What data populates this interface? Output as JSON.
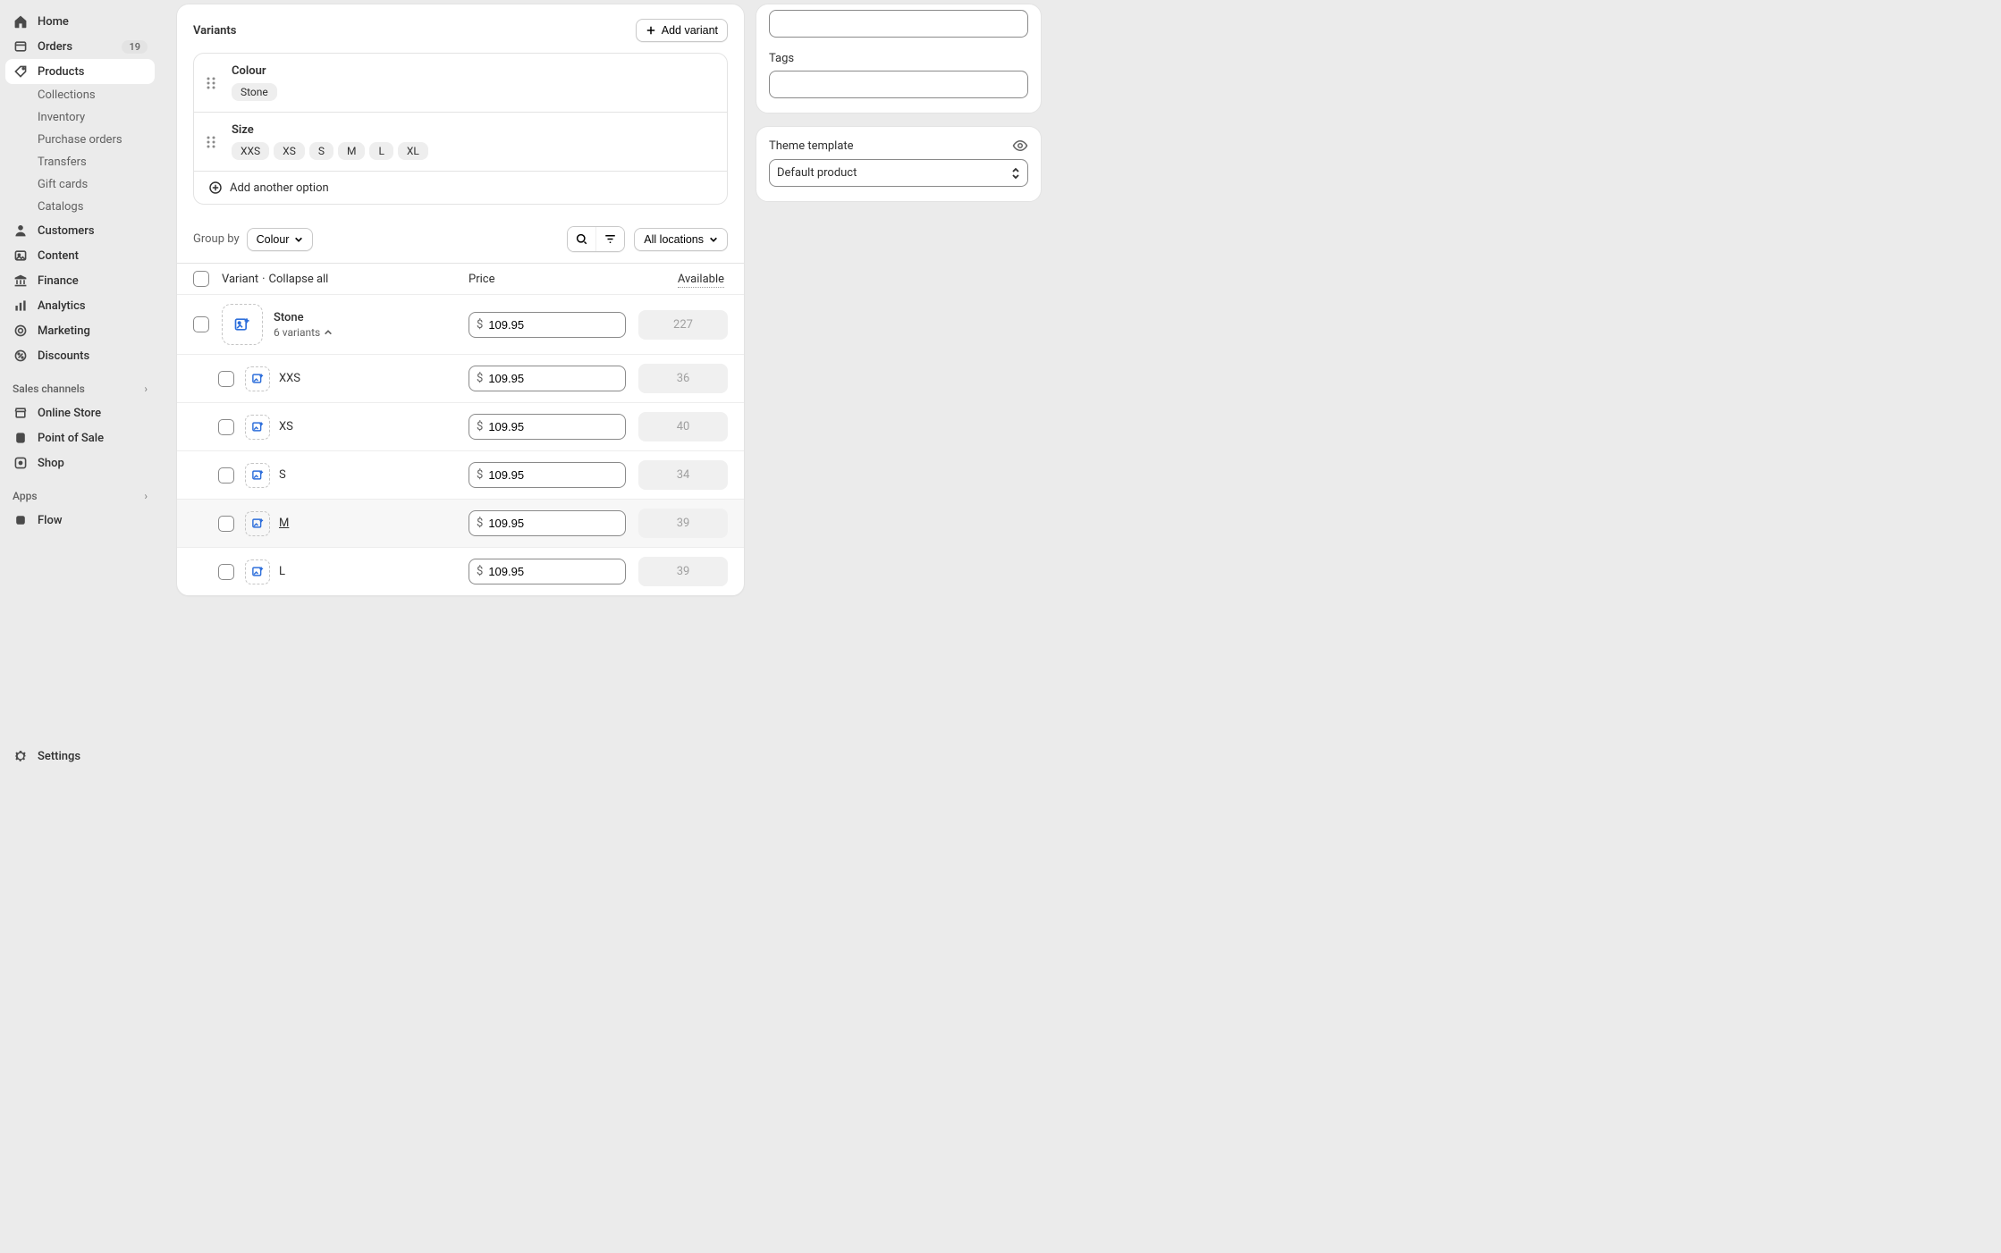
{
  "sidebar": {
    "home": "Home",
    "orders": "Orders",
    "orders_badge": "19",
    "products": "Products",
    "products_sub": [
      "Collections",
      "Inventory",
      "Purchase orders",
      "Transfers",
      "Gift cards",
      "Catalogs"
    ],
    "customers": "Customers",
    "content": "Content",
    "finance": "Finance",
    "analytics": "Analytics",
    "marketing": "Marketing",
    "discounts": "Discounts",
    "sales_header": "Sales channels",
    "online_store": "Online Store",
    "pos": "Point of Sale",
    "shop": "Shop",
    "apps_header": "Apps",
    "flow": "Flow",
    "settings": "Settings"
  },
  "variants": {
    "title": "Variants",
    "add_variant": "Add variant",
    "options": [
      {
        "name": "Colour",
        "values": [
          "Stone"
        ]
      },
      {
        "name": "Size",
        "values": [
          "XXS",
          "XS",
          "S",
          "M",
          "L",
          "XL"
        ]
      }
    ],
    "add_option": "Add another option",
    "group_by_label": "Group by",
    "group_by_value": "Colour",
    "locations": "All locations",
    "header": {
      "variant": "Variant",
      "collapse": "Collapse all",
      "price": "Price",
      "available": "Available"
    },
    "currency": "$",
    "group": {
      "name": "Stone",
      "count": "6 variants",
      "price": "109.95",
      "available": "227"
    },
    "rows": [
      {
        "name": "XXS",
        "price": "109.95",
        "available": "36"
      },
      {
        "name": "XS",
        "price": "109.95",
        "available": "40"
      },
      {
        "name": "S",
        "price": "109.95",
        "available": "34"
      },
      {
        "name": "M",
        "price": "109.95",
        "available": "39"
      },
      {
        "name": "L",
        "price": "109.95",
        "available": "39"
      }
    ]
  },
  "right": {
    "tags_label": "Tags",
    "theme_label": "Theme template",
    "theme_value": "Default product"
  }
}
